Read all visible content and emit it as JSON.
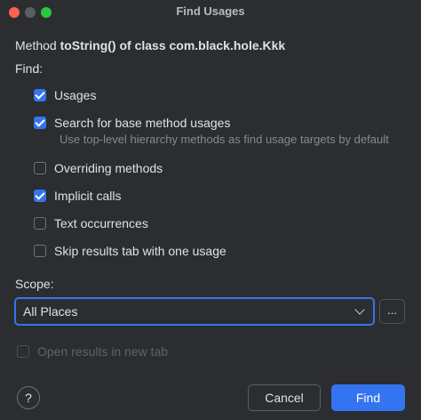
{
  "window": {
    "title": "Find Usages"
  },
  "header": {
    "method_prefix": "Method",
    "method_name": "toString() of class com.black.hole.Kkk"
  },
  "find": {
    "label": "Find:",
    "options": [
      {
        "label": "Usages",
        "checked": true
      },
      {
        "label": "Search for base method usages",
        "checked": true
      },
      {
        "label": "Overriding methods",
        "checked": false
      },
      {
        "label": "Implicit calls",
        "checked": true
      },
      {
        "label": "Text occurrences",
        "checked": false
      },
      {
        "label": "Skip results tab with one usage",
        "checked": false
      }
    ],
    "base_method_hint": "Use top-level hierarchy methods as find usage targets by default"
  },
  "scope": {
    "label": "Scope:",
    "selected": "All Places",
    "more_button": "..."
  },
  "open_in_new_tab": {
    "label": "Open results in new tab",
    "checked": false,
    "enabled": false
  },
  "footer": {
    "help": "?",
    "cancel": "Cancel",
    "find": "Find"
  },
  "colors": {
    "background": "#2b2d30",
    "accent": "#3574f0",
    "text": "#dfe1e5",
    "muted_text": "#868a91"
  }
}
